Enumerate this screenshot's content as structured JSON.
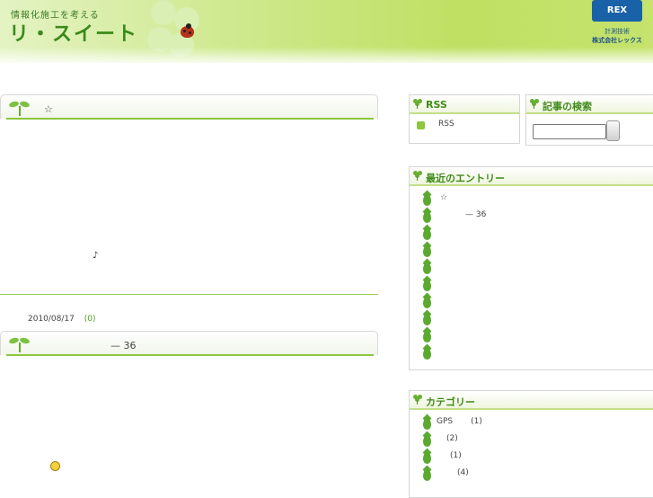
{
  "header": {
    "tagline": "情報化施工を考える",
    "site_title": "リ・スイート",
    "company_mark": "REX",
    "company_line1": "計測技術",
    "company_line2": "株式会社レックス"
  },
  "posts": [
    {
      "title": "☆"
    },
    {
      "title": "— 36",
      "date": "2010/08/17",
      "comments": "(0)"
    }
  ],
  "post_note": "♪",
  "sidebar": {
    "rss": {
      "heading": "RSS",
      "link": "RSS"
    },
    "search": {
      "heading": "記事の検索",
      "value": "",
      "button_label": ""
    },
    "recent": {
      "heading": "最近のエントリー",
      "items": [
        "☆",
        "— 36",
        "",
        "",
        "",
        "",
        "",
        "",
        "",
        ""
      ]
    },
    "categories": {
      "heading": "カテゴリー",
      "items": [
        {
          "name": "GPS",
          "count": "(1)"
        },
        {
          "name": "",
          "count": "(2)"
        },
        {
          "name": "",
          "count": "(1)"
        },
        {
          "name": "",
          "count": "(4)"
        }
      ]
    }
  },
  "colors": {
    "accent": "#3f8a1a",
    "leaf": "#5aaa2f",
    "rule": "#9ccc5a",
    "brand_blue": "#1a62a8"
  }
}
